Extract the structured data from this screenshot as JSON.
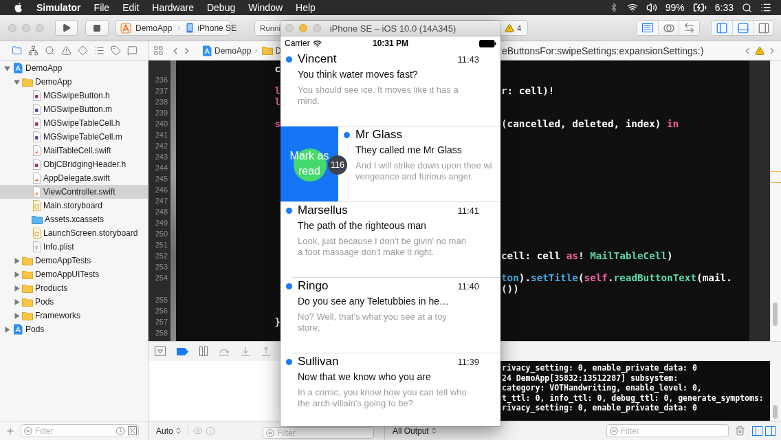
{
  "menu_bar": {
    "app_name": "Simulator",
    "menus": [
      "File",
      "Edit",
      "Hardware",
      "Debug",
      "Window",
      "Help"
    ],
    "battery": "99%",
    "clock": "6:33"
  },
  "toolbar": {
    "scheme": {
      "project": "DemoApp",
      "device": "iPhone SE"
    },
    "activity": {
      "status": "Runni",
      "warning_count": "4"
    },
    "editor_modes": [
      {
        "kind": "standard",
        "selected": true
      },
      {
        "kind": "assistant",
        "selected": false
      },
      {
        "kind": "version",
        "selected": false
      }
    ],
    "panel_toggles": [
      {
        "kind": "navigator",
        "selected": true
      },
      {
        "kind": "debug",
        "selected": true
      },
      {
        "kind": "utilities",
        "selected": false
      }
    ]
  },
  "navigator": {
    "tabs": [
      {
        "kind": "project",
        "selected": true
      },
      {
        "kind": "symbol",
        "selected": false
      },
      {
        "kind": "find",
        "selected": false
      },
      {
        "kind": "issue",
        "selected": false
      },
      {
        "kind": "test",
        "selected": false
      },
      {
        "kind": "debug",
        "selected": false
      },
      {
        "kind": "breakpoint",
        "selected": false
      },
      {
        "kind": "report",
        "selected": false
      }
    ],
    "tree": [
      {
        "label": "DemoApp",
        "kind": "project",
        "expanded": true,
        "selected": false,
        "children": [
          {
            "label": "DemoApp",
            "kind": "folder",
            "expanded": true,
            "selected": false,
            "children": [
              {
                "label": "MGSwipeButton.h",
                "kind": "header",
                "selected": false
              },
              {
                "label": "MGSwipeButton.m",
                "kind": "objc",
                "selected": false
              },
              {
                "label": "MGSwipeTableCell.h",
                "kind": "header",
                "selected": false
              },
              {
                "label": "MGSwipeTableCell.m",
                "kind": "objc",
                "selected": false
              },
              {
                "label": "MailTableCell.swift",
                "kind": "swift",
                "selected": false
              },
              {
                "label": "ObjCBridgingHeader.h",
                "kind": "header",
                "selected": false
              },
              {
                "label": "AppDelegate.swift",
                "kind": "swift",
                "selected": false
              },
              {
                "label": "ViewController.swift",
                "kind": "swift",
                "selected": true
              },
              {
                "label": "Main.storyboard",
                "kind": "storyboard",
                "selected": false
              },
              {
                "label": "Assets.xcassets",
                "kind": "assets",
                "selected": false
              },
              {
                "label": "LaunchScreen.storyboard",
                "kind": "storyboard",
                "selected": false
              },
              {
                "label": "Info.plist",
                "kind": "plist",
                "selected": false
              }
            ]
          },
          {
            "label": "DemoAppTests",
            "kind": "folder",
            "expanded": false,
            "selected": false
          },
          {
            "label": "DemoAppUITests",
            "kind": "folder",
            "expanded": false,
            "selected": false
          },
          {
            "label": "Products",
            "kind": "folder",
            "expanded": false,
            "selected": false
          },
          {
            "label": "Pods",
            "kind": "folder",
            "expanded": false,
            "selected": false
          },
          {
            "label": "Frameworks",
            "kind": "folder",
            "expanded": false,
            "selected": false
          }
        ]
      },
      {
        "label": "Pods",
        "kind": "project",
        "expanded": false,
        "selected": false
      }
    ],
    "filter": {
      "placeholder": "Filter"
    }
  },
  "jump_bar": {
    "path": [
      {
        "kind": "project",
        "label": "DemoApp"
      },
      {
        "kind": "folder",
        "label": "D"
      }
    ],
    "symbol": "eButtonsFor:swipeSettings:expansionSettings:)"
  },
  "editor": {
    "rows": [
      {
        "left": [
          {
            "kind": "plain",
            "text": "c"
          }
        ]
      },
      {
        "number": "236"
      },
      {
        "number": "237",
        "left": [
          {
            "kind": "keyword",
            "text": "l"
          }
        ],
        "right": [
          {
            "kind": "plain",
            "text": "r: cell)!"
          }
        ]
      },
      {
        "number": "238",
        "left": [
          {
            "kind": "keyword",
            "text": "l"
          }
        ]
      },
      {
        "number": "239"
      },
      {
        "number": "240",
        "left": [
          {
            "kind": "keyword",
            "text": "s"
          }
        ],
        "right": [
          {
            "kind": "plain",
            "text": "(cancelled, deleted, index) "
          },
          {
            "kind": "keyword",
            "text": "in"
          }
        ]
      },
      {
        "number": "241"
      },
      {
        "number": "242"
      },
      {
        "number": "243"
      },
      {
        "number": "244"
      },
      {
        "number": "245"
      },
      {
        "number": "246"
      },
      {
        "number": "247"
      },
      {
        "number": "248"
      },
      {
        "number": "249"
      },
      {
        "number": "250"
      },
      {
        "number": "251"
      },
      {
        "number": "252",
        "right": [
          {
            "kind": "plain",
            "text": "cell: cell "
          },
          {
            "kind": "keyword",
            "text": "as"
          },
          {
            "kind": "plain",
            "text": "! "
          },
          {
            "kind": "project",
            "text": "MailTableCell"
          },
          {
            "kind": "plain",
            "text": ")"
          }
        ]
      },
      {
        "number": "253"
      },
      {
        "number": "254",
        "right": [
          {
            "kind": "system",
            "text": "ton"
          },
          {
            "kind": "plain",
            "text": ")."
          },
          {
            "kind": "system",
            "text": "setTitle"
          },
          {
            "kind": "plain",
            "text": "("
          },
          {
            "kind": "keyword",
            "text": "self"
          },
          {
            "kind": "plain",
            "text": "."
          },
          {
            "kind": "project",
            "text": "readButtonText"
          },
          {
            "kind": "plain",
            "text": "(mail."
          }
        ]
      },
      {
        "right": [
          {
            "kind": "plain",
            "text": "())"
          }
        ]
      },
      {
        "number": "255"
      },
      {
        "number": "256"
      },
      {
        "number": "257",
        "left": [
          {
            "kind": "plain",
            "text": "}"
          }
        ]
      },
      {
        "number": "258"
      }
    ]
  },
  "debug_bar": {
    "breakpoints_active": true
  },
  "console": {
    "lines": [
      "rivacy_setting: 0, enable_private_data: 0",
      "24 DemoApp[35832:13512287] subsystem:",
      "category: VOTHandwriting, enable_level: 0,",
      "t_ttl: 0, info_ttl: 0, debug_ttl: 0, generate_symptoms:",
      "rivacy_setting: 0, enable_private_data: 0"
    ]
  },
  "debug_footer": {
    "scope": "Auto",
    "variables_filter": {
      "placeholder": "Filter"
    },
    "output": "All Output",
    "console_filter": {
      "placeholder": "Filter"
    },
    "views": [
      {
        "kind": "variables",
        "selected": true
      },
      {
        "kind": "console",
        "selected": true
      }
    ]
  },
  "simulator": {
    "title": "iPhone SE – iOS 10.0 (14A345)",
    "status_bar": {
      "carrier": "Carrier",
      "time": "10:31 PM"
    },
    "mails": [
      {
        "sender": "Vincent",
        "time": "11:43",
        "subject": "You think water moves fast?",
        "preview": "You should see ice. It moves like it has a\nmind.",
        "unread": true,
        "swiped": false
      },
      {
        "sender": "Mr Glass",
        "subject": "They called me Mr Glass",
        "preview": "And I will strike down upon thee wi\nvengeance and furious anger.",
        "unread": true,
        "swiped": true,
        "action": "Mark as read"
      },
      {
        "sender": "Marsellus",
        "time": "11:41",
        "subject": "The path of the righteous man",
        "preview": "Look, just because I don't be givin' no man\na foot massage don't make it right.",
        "unread": true,
        "swiped": false
      },
      {
        "sender": "Ringo",
        "time": "11:40",
        "subject": "Do you see any Teletubbies in he…",
        "preview": "No? Well, that's what you see at a toy\nstore.",
        "unread": true,
        "swiped": false
      },
      {
        "sender": "Sullivan",
        "time": "11:39",
        "subject": "Now that we know who you are",
        "preview": "In a comic, you know how you can tell who\nthe arch-villain's going to be?",
        "unread": true,
        "swiped": false
      }
    ],
    "click_count": "116"
  }
}
